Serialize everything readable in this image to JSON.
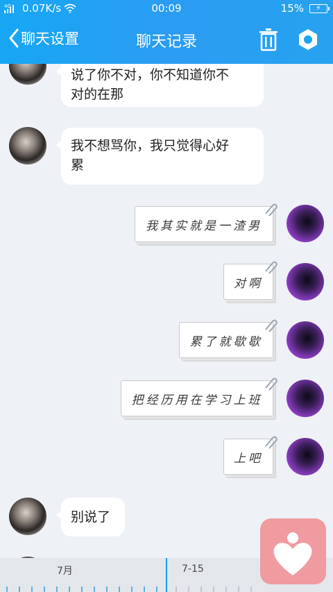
{
  "status_bar": {
    "network_label": "4G",
    "speed": "0.07K/s",
    "time": "00:09",
    "battery": "15%"
  },
  "nav": {
    "back_label": "聊天设置",
    "title": "聊天记录"
  },
  "messages": [
    {
      "side": "left",
      "text_line1": "说了你不对，你不知道你不",
      "text_line2": "对的在那"
    },
    {
      "side": "left",
      "text_line1": "我不想骂你，我只觉得心好",
      "text_line2": "累"
    },
    {
      "side": "right",
      "text": "我其实就是一渣男"
    },
    {
      "side": "right",
      "text": "对啊"
    },
    {
      "side": "right",
      "text": "累了就歇歇"
    },
    {
      "side": "right",
      "text": "把经历用在学习上班"
    },
    {
      "side": "right",
      "text": "上吧"
    },
    {
      "side": "left",
      "text": "别说了"
    }
  ],
  "timeline": {
    "label_left": "7月",
    "label_right": "7-15"
  },
  "colors": {
    "header": "#1fa3f3",
    "accent": "#1a9ef0",
    "float_button": "#ef9ba0"
  }
}
